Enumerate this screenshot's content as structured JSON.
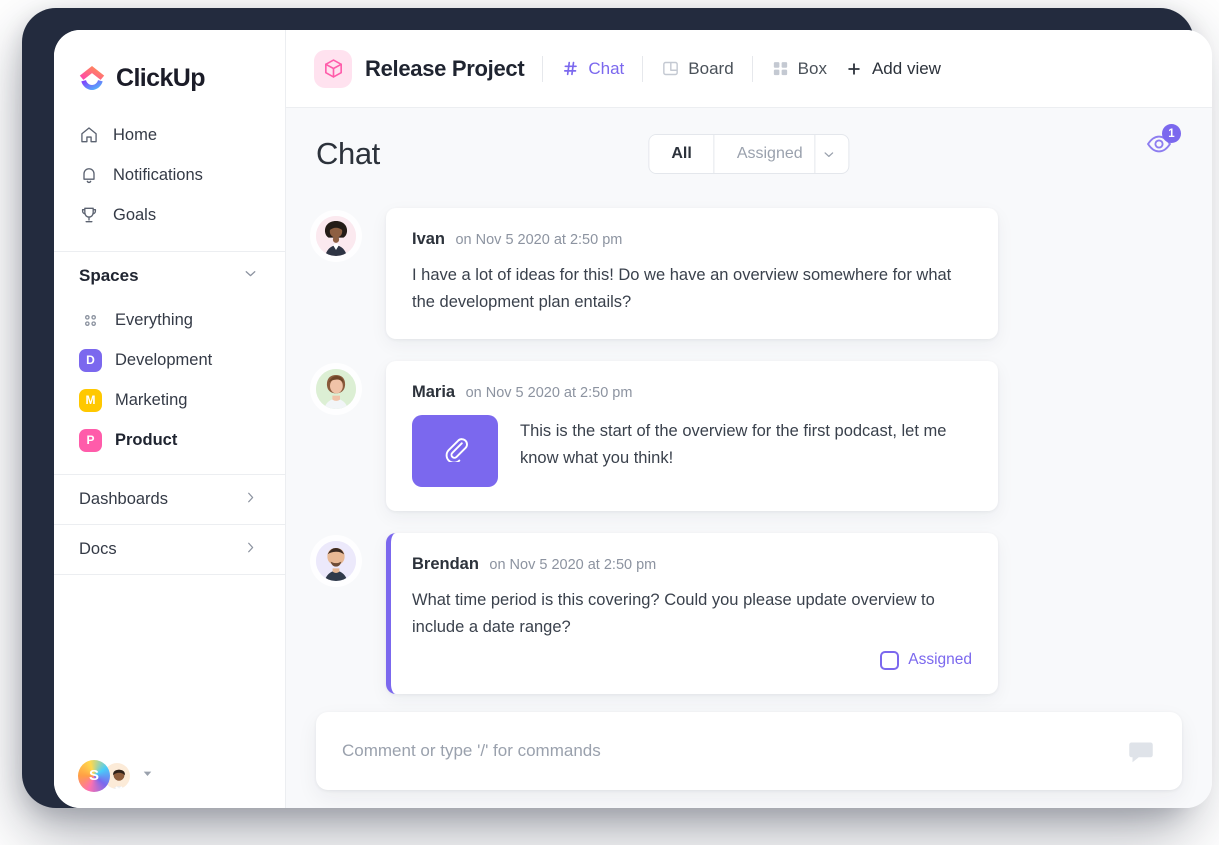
{
  "brand": {
    "name": "ClickUp",
    "accent": "#7b68ee",
    "logo_icon": "clickup-logo-icon"
  },
  "sidebar": {
    "nav": [
      {
        "label": "Home",
        "icon": "home-icon"
      },
      {
        "label": "Notifications",
        "icon": "bell-icon"
      },
      {
        "label": "Goals",
        "icon": "trophy-icon"
      }
    ],
    "spaces_header": {
      "label": "Spaces",
      "icon": "chevron-down-icon"
    },
    "spaces": [
      {
        "label": "Everything",
        "badge": "",
        "color": "",
        "icon": "grid-dots-icon",
        "active": false
      },
      {
        "label": "Development",
        "badge": "D",
        "color": "#7b68ee",
        "active": false
      },
      {
        "label": "Marketing",
        "badge": "M",
        "color": "#ffc800",
        "active": false
      },
      {
        "label": "Product",
        "badge": "P",
        "color": "#ff5caa",
        "active": true
      }
    ],
    "collapsibles": [
      {
        "label": "Dashboards",
        "icon": "chevron-right-icon"
      },
      {
        "label": "Docs",
        "icon": "chevron-right-icon"
      }
    ],
    "footer": {
      "workspace_initial": "S",
      "avatar": "user-avatar",
      "caret": "caret-down-icon"
    }
  },
  "topbar": {
    "project_icon": "box-cube-icon",
    "project_title": "Release Project",
    "views": [
      {
        "label": "Chat",
        "icon": "hash-icon",
        "active": true
      },
      {
        "label": "Board",
        "icon": "board-columns-icon",
        "active": false
      },
      {
        "label": "Box",
        "icon": "grid-squares-icon",
        "active": false
      }
    ],
    "add_view": {
      "label": "Add view",
      "icon": "plus-icon"
    }
  },
  "page": {
    "title": "Chat",
    "filter": {
      "all_label": "All",
      "assigned_label": "Assigned",
      "caret_icon": "chevron-down-icon",
      "selected": "All"
    },
    "watchers": {
      "count": "1",
      "icon": "eye-icon"
    }
  },
  "messages": [
    {
      "author": "Ivan",
      "time": "on Nov 5 2020 at 2:50 pm",
      "text": "I have a lot of ideas for this! Do we have an overview somewhere for what the development plan entails?",
      "avatar_bg": "#fbe9ef",
      "accent": false,
      "attachment": null,
      "assigned": null
    },
    {
      "author": "Maria",
      "time": "on Nov 5 2020 at 2:50 pm",
      "text": "This is the start of the overview for the first podcast, let me know what you think!",
      "avatar_bg": "#e4f2de",
      "accent": false,
      "attachment": {
        "icon": "paperclip-icon",
        "color": "#7b68ee"
      },
      "assigned": null
    },
    {
      "author": "Brendan",
      "time": "on Nov 5 2020 at 2:50 pm",
      "text": "What time period is this covering? Could you please update overview to include a date range?",
      "avatar_bg": "#ece9fb",
      "accent": true,
      "attachment": null,
      "assigned": {
        "label": "Assigned",
        "checked": false
      }
    }
  ],
  "composer": {
    "placeholder": "Comment or type '/' for commands",
    "icon": "comment-bubble-icon"
  }
}
